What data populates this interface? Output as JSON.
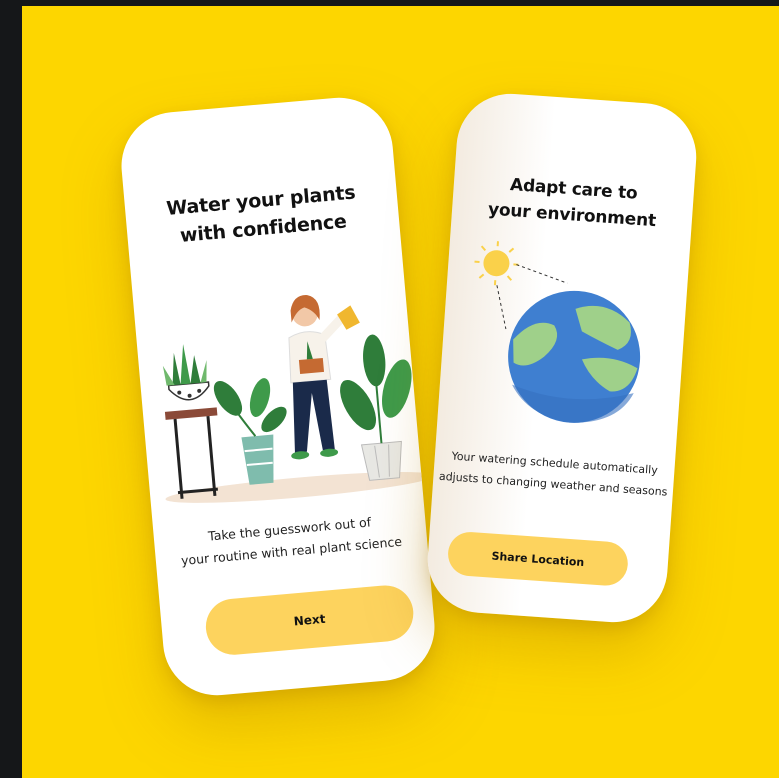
{
  "screens": [
    {
      "title_line1": "Water your plants",
      "title_line2": "with confidence",
      "body_line1": "Take the guesswork out of",
      "body_line2": "your routine with real plant science",
      "button_label": "Next"
    },
    {
      "title_line1": "Adapt care to",
      "title_line2": "your environment",
      "body_line1": "Your watering schedule automatically",
      "body_line2": "adjusts to changing weather and seasons",
      "button_label": "Share Location"
    }
  ],
  "colors": {
    "background": "#FDD600",
    "frame": "#151719",
    "button": "#FDD35E",
    "earth_ocean": "#3F7FD0",
    "earth_land": "#9FD08A",
    "sun": "#FAD14A",
    "plant_green": "#2F7D3A"
  },
  "icons": [
    "sun-icon",
    "earth-icon",
    "plant-icon",
    "woman-illustration"
  ]
}
